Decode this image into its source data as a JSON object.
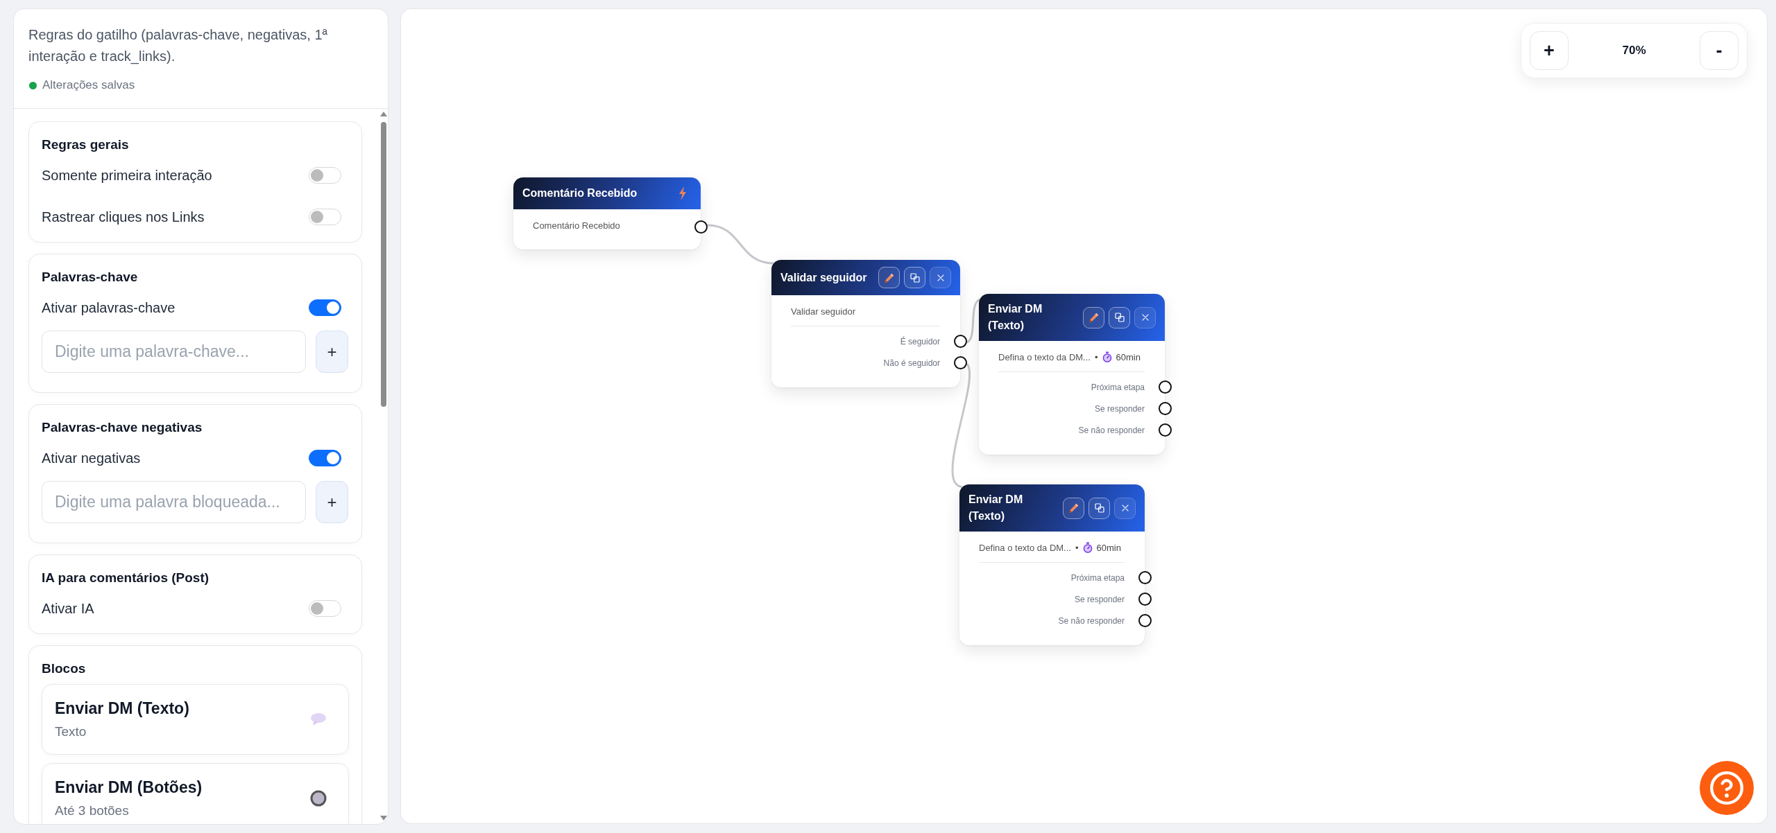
{
  "sidebar": {
    "description": "Regras do gatilho (palavras-chave, negativas, 1ª interação e track_links).",
    "status": {
      "label": "Alterações salvas",
      "saved": true
    },
    "sections": [
      {
        "kind": "toggles",
        "title": "Regras gerais",
        "toggles": [
          {
            "label": "Somente primeira interação",
            "on": false
          },
          {
            "label": "Rastrear cliques nos Links",
            "on": false
          }
        ]
      },
      {
        "kind": "keywords",
        "title": "Palavras-chave",
        "toggles": [
          {
            "label": "Ativar palavras-chave",
            "on": true
          }
        ],
        "input": {
          "placeholder": "Digite uma palavra-chave..."
        },
        "add_button": "+"
      },
      {
        "kind": "keywords",
        "title": "Palavras-chave negativas",
        "toggles": [
          {
            "label": "Ativar negativas",
            "on": true
          }
        ],
        "input": {
          "placeholder": "Digite uma palavra bloqueada..."
        },
        "add_button": "+"
      },
      {
        "kind": "toggles",
        "title": "IA para comentários (Post)",
        "toggles": [
          {
            "label": "Ativar IA",
            "on": false
          }
        ]
      },
      {
        "kind": "blocks",
        "title": "Blocos",
        "blocks": [
          {
            "kind": "text",
            "title": "Enviar DM (Texto)",
            "subtitle": "Texto"
          },
          {
            "kind": "buttons",
            "title": "Enviar DM (Botões)",
            "subtitle": "Até 3 botões"
          }
        ]
      }
    ]
  },
  "canvas": {
    "zoom": {
      "zoom_in": "+",
      "reading": "70%",
      "zoom_out": "-"
    },
    "nodes": [
      {
        "kind": "trigger",
        "title": "Comentário Recebido",
        "summary": "Comentário Recebido",
        "outputs": [
          {
            "connected": true
          }
        ]
      },
      {
        "kind": "condition",
        "title": "Validar seguidor",
        "summary": "Validar seguidor",
        "outputs": [
          {
            "label": "É seguidor",
            "connected": true
          },
          {
            "label": "Não é seguidor",
            "connected": true
          }
        ]
      },
      {
        "kind": "message",
        "title": "Enviar DM (Texto)",
        "summary": "Defina o texto da DM...",
        "separator": "•",
        "delay": "60min",
        "outputs": [
          {
            "label": "Próxima etapa",
            "connected": false
          },
          {
            "label": "Se responder",
            "connected": false
          },
          {
            "label": "Se não responder",
            "connected": false
          }
        ]
      },
      {
        "kind": "message",
        "title": "Enviar DM (Texto)",
        "summary": "Defina o texto da DM...",
        "separator": "•",
        "delay": "60min",
        "outputs": [
          {
            "label": "Próxima etapa",
            "connected": false
          },
          {
            "label": "Se responder",
            "connected": false
          },
          {
            "label": "Se não responder",
            "connected": false
          }
        ]
      }
    ]
  }
}
